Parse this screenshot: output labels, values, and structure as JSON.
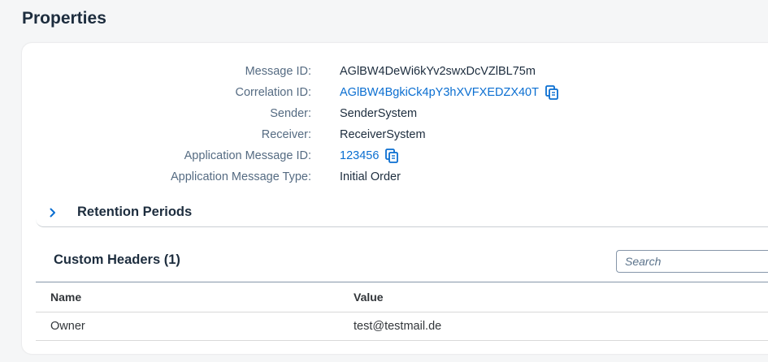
{
  "page": {
    "title": "Properties"
  },
  "properties": [
    {
      "label": "Message ID:",
      "value": "AGlBW4DeWi6kYv2swxDcVZlBL75m",
      "link": false,
      "copy": false
    },
    {
      "label": "Correlation ID:",
      "value": "AGlBW4BgkiCk4pY3hXVFXEDZX40T",
      "link": true,
      "copy": true
    },
    {
      "label": "Sender:",
      "value": "SenderSystem",
      "link": false,
      "copy": false
    },
    {
      "label": "Receiver:",
      "value": "ReceiverSystem",
      "link": false,
      "copy": false
    },
    {
      "label": "Application Message ID:",
      "value": "123456",
      "link": true,
      "copy": true
    },
    {
      "label": "Application Message Type:",
      "value": "Initial Order",
      "link": false,
      "copy": false
    }
  ],
  "retention": {
    "title": "Retention Periods",
    "icon": "chevron-right-icon"
  },
  "custom_headers": {
    "title": "Custom Headers (1)",
    "search_placeholder": "Search",
    "columns": [
      "Name",
      "Value"
    ],
    "rows": [
      {
        "name": "Owner",
        "value": "test@testmail.de"
      }
    ]
  },
  "colors": {
    "link": "#0a6ed1",
    "label": "#556b82",
    "text": "#1d2d3e"
  }
}
